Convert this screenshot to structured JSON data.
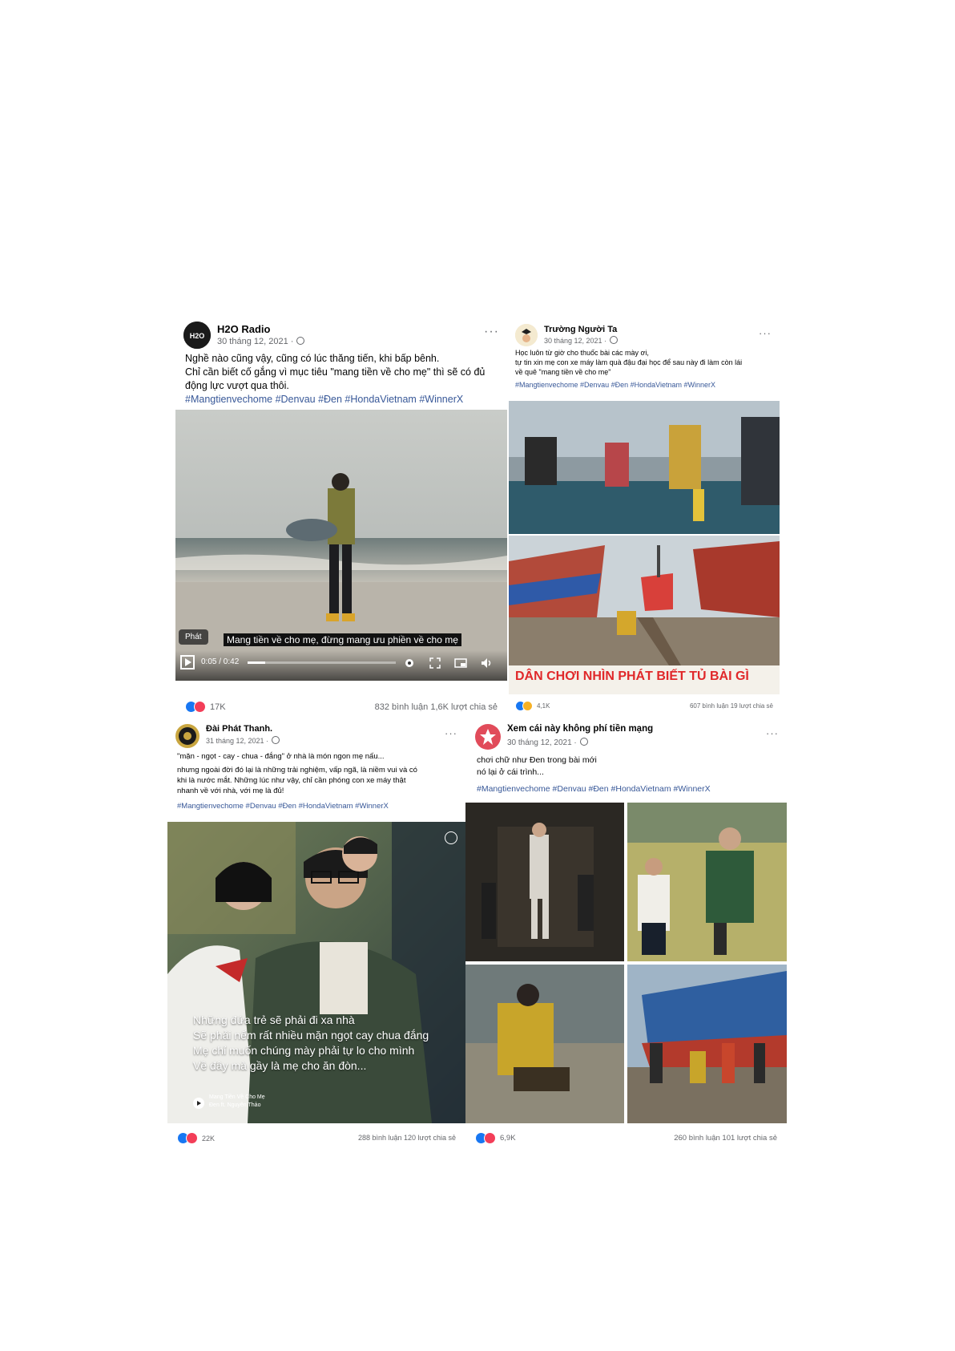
{
  "posts": [
    {
      "name": "H2O Radio",
      "date": "30 tháng 12, 2021 ·",
      "more": "···",
      "lines": [
        "Nghề nào cũng vậy, cũng có lúc thăng tiến, khi bấp bênh.",
        "Chỉ cần biết cố gắng vì mục tiêu \"mang tiền về cho mẹ\" thì sẽ có đủ",
        "động lực vượt qua thôi."
      ],
      "hashtags": "#Mangtienvechome #Denvau #Đen #HondaVietnam #WinnerX",
      "video": {
        "play_label": "Phát",
        "subtitle": "Mang tiền về cho mẹ, đừng mang ưu phiền về cho mẹ",
        "time": "0:05 / 0:42",
        "progress": 0.12
      },
      "reactions": "17K",
      "stats": "832 bình luận  1,6K lượt chia sẻ"
    },
    {
      "name": "Trường Người Ta",
      "date": "30 tháng 12, 2021 ·",
      "more": "···",
      "lines": [
        "Học luôn từ giờ cho thuốc bài các mày ơi,",
        "tự tin xin mẹ con xe máy làm quà đậu đại học để sau này đi làm còn lái",
        "về quê \"mang tiền về cho mẹ\""
      ],
      "hashtags": "#Mangtienvechome #Denvau #Đen #HondaVietnam #WinnerX",
      "banner": "DÂN CHƠI NHÌN PHÁT BIẾT TỦ BÀI GÌ",
      "reactions": "4,1K",
      "stats": "607 bình luận  19 lượt chia sẻ"
    },
    {
      "name": "Đài Phát Thanh.",
      "date": "31 tháng 12, 2021 ·",
      "more": "···",
      "lines": [
        "\"mặn - ngọt - cay - chua - đắng\" ở nhà là món ngon mẹ nấu...",
        "nhưng ngoài đời đó lại là những trải nghiệm, vấp ngã, là niềm vui và có",
        "khi là nước mắt. Những lúc như vậy, chỉ cần phóng con xe máy thật",
        "nhanh về với nhà, với mẹ là đủ!"
      ],
      "hashtags": "#Mangtienvechome #Denvau #Đen #HondaVietnam #WinnerX",
      "lyrics": [
        "Những đứa trẻ sẽ phải đi xa nhà",
        "Sẽ phải nếm rất nhiều mặn ngọt cay chua đắng",
        "Mẹ chỉ muốn chúng mày phải tự lo cho mình",
        "Về đây mà gầy là mẹ cho ăn đòn..."
      ],
      "track_title": "Mang Tiền Về Cho Mẹ",
      "track_artist": "Đen ft. Nguyên Thảo",
      "reactions": "22K",
      "stats": "288 bình luận  120 lượt chia sẻ"
    },
    {
      "name": "Xem cái này không phí tiền mạng",
      "date": "30 tháng 12, 2021 ·",
      "more": "···",
      "lines": [
        "chơi chữ như Đen trong bài mới",
        "nó lại ở cái trình..."
      ],
      "hashtags": "#Mangtienvechome #Denvau #Đen #HondaVietnam #WinnerX",
      "reactions": "6,9K",
      "stats": "260 bình luận  101 lượt chia sẻ"
    }
  ]
}
